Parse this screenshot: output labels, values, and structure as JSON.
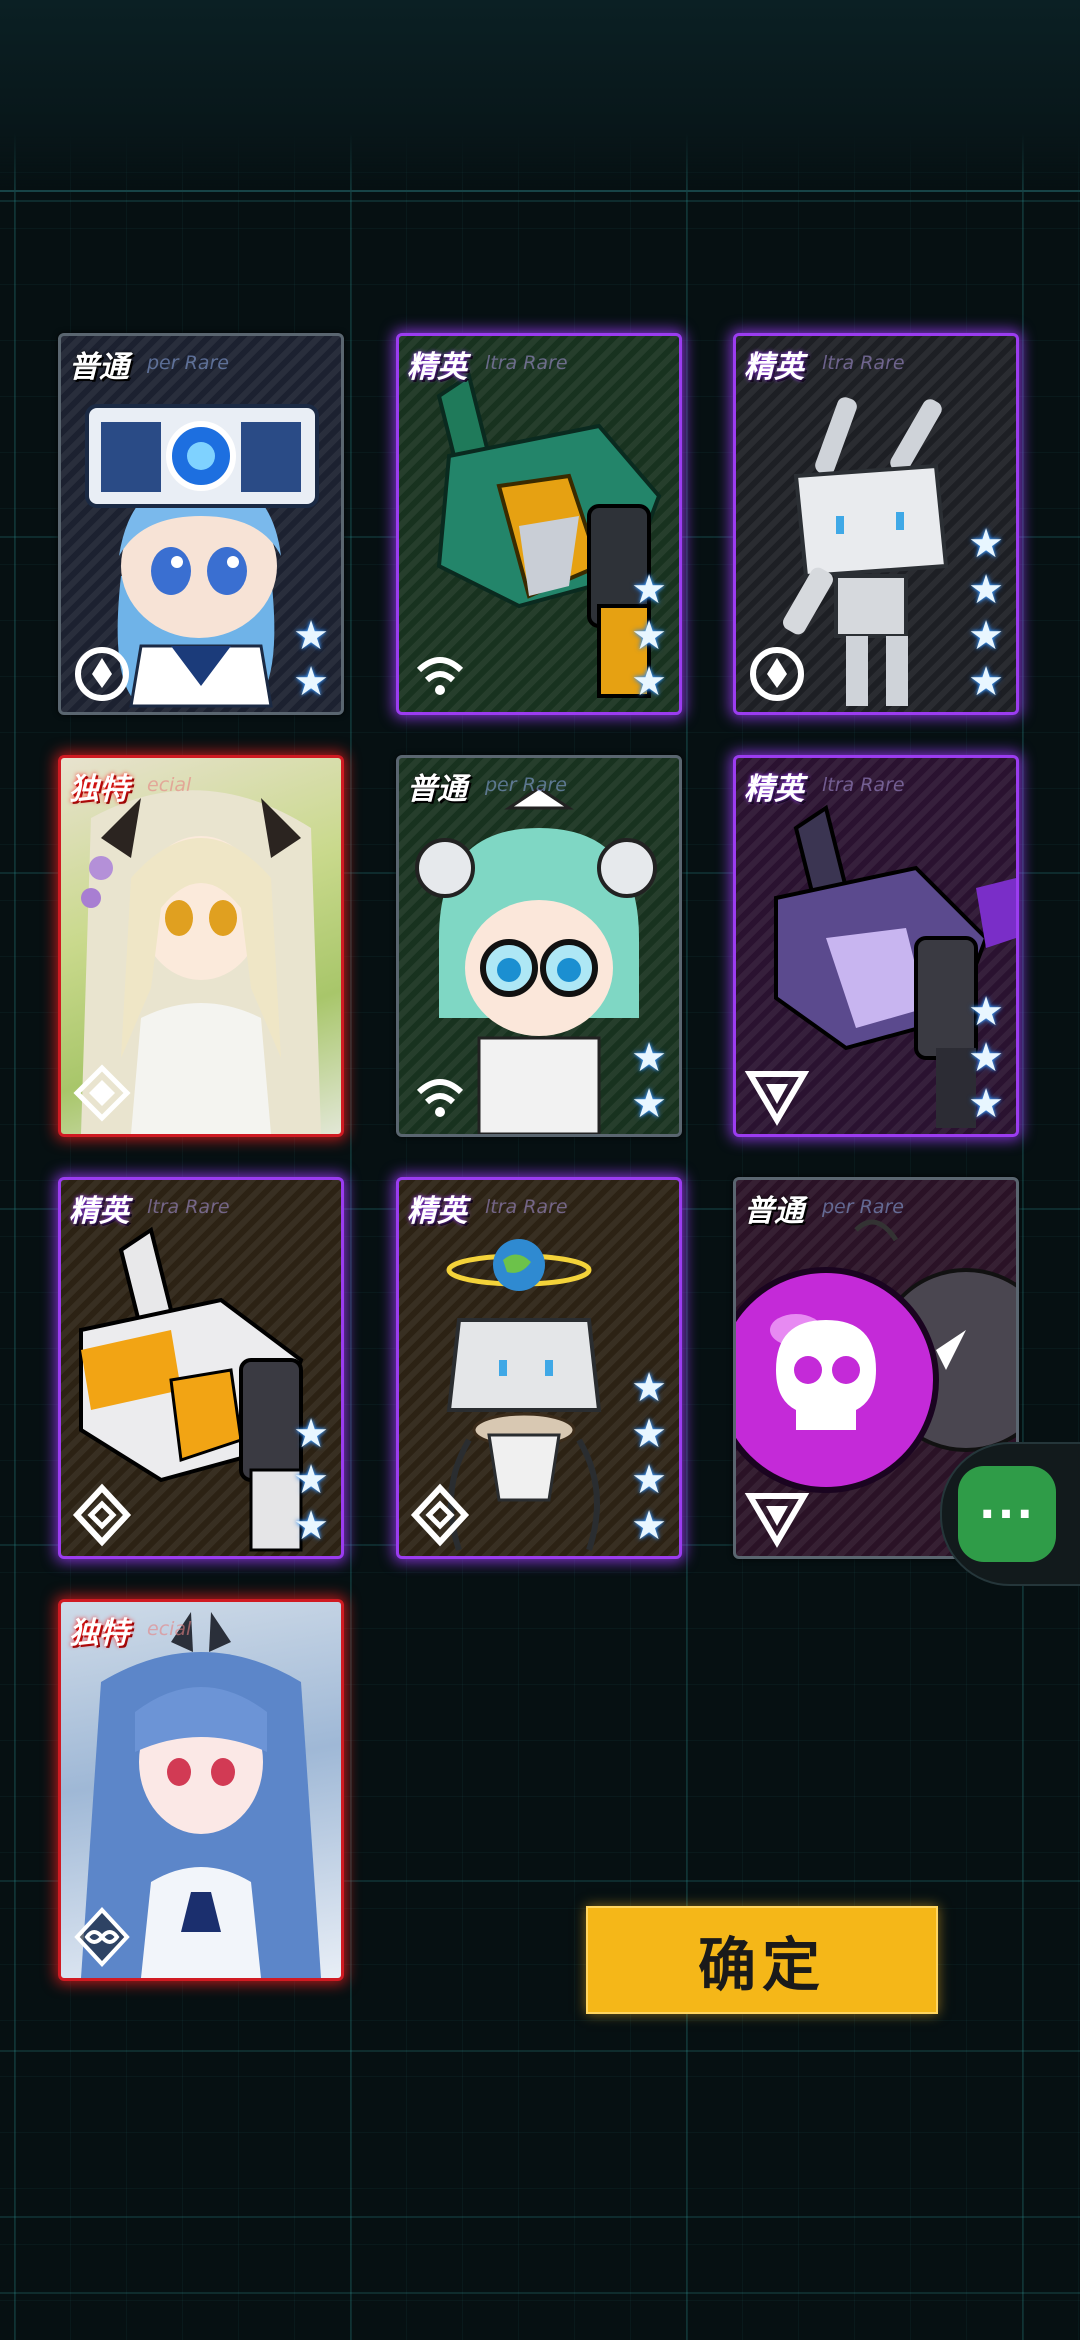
{
  "cards": [
    {
      "rank": "普通",
      "rarity": "per Rare",
      "stars": "★",
      "star_count": 2,
      "class_icon": "shield-circle-icon",
      "tier": "normal",
      "portrait": "chibi-girl-visor"
    },
    {
      "rank": "精英",
      "rarity": "ltra Rare",
      "stars": "★",
      "star_count": 3,
      "class_icon": "signal-icon",
      "tier": "elite",
      "portrait": "green-mech"
    },
    {
      "rank": "精英",
      "rarity": "ltra Rare",
      "stars": "★",
      "star_count": 4,
      "class_icon": "shield-circle-icon",
      "tier": "elite",
      "portrait": "white-box-robot"
    },
    {
      "rank": "独特",
      "rarity": "ecial",
      "stars": "★",
      "star_count": 0,
      "class_icon": "diamond-cross-icon",
      "tier": "unique",
      "portrait": "blonde-girl-art"
    },
    {
      "rank": "普通",
      "rarity": "per Rare",
      "stars": "★",
      "star_count": 2,
      "class_icon": "signal-icon",
      "tier": "normal",
      "portrait": "chibi-girl-glasses"
    },
    {
      "rank": "精英",
      "rarity": "ltra Rare",
      "stars": "★",
      "star_count": 3,
      "class_icon": "triangle-icon",
      "tier": "elite",
      "portrait": "purple-mech"
    },
    {
      "rank": "精英",
      "rarity": "ltra Rare",
      "stars": "★",
      "star_count": 3,
      "class_icon": "rhombus-icon",
      "tier": "elite",
      "portrait": "white-orange-mech"
    },
    {
      "rank": "精英",
      "rarity": "ltra Rare",
      "stars": "★",
      "star_count": 4,
      "class_icon": "rhombus-icon",
      "tier": "elite",
      "portrait": "box-robot-planet"
    },
    {
      "rank": "普通",
      "rarity": "per Rare",
      "stars": "★",
      "star_count": 0,
      "class_icon": "triangle-icon",
      "tier": "normal",
      "portrait": "skull-bomb"
    },
    {
      "rank": "独特",
      "rarity": "ecial",
      "stars": "★",
      "star_count": 0,
      "class_icon": "infinity-icon",
      "tier": "unique",
      "portrait": "blue-hair-girl-art"
    }
  ],
  "confirm_label": "确定",
  "floating_button": {
    "label": "···",
    "icon": "more-dots-icon",
    "color": "#2f9c48"
  },
  "colors": {
    "elite": "#9b3cf0",
    "unique": "#d01a22",
    "normal": "#5a6670",
    "confirm": "#f5b718"
  }
}
